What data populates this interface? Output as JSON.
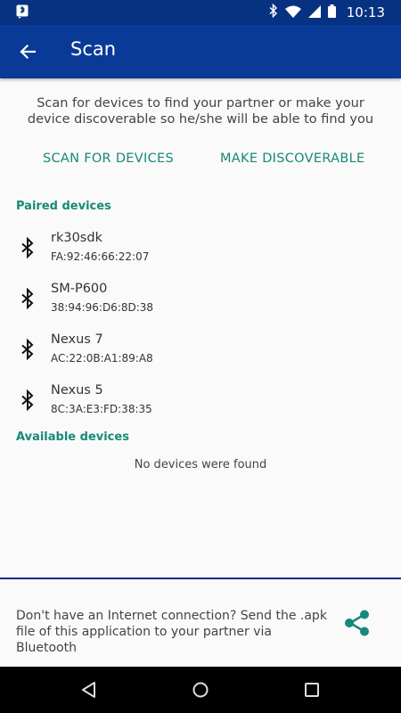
{
  "status_bar": {
    "time": "10:13",
    "left_icon": "notification-app-icon",
    "right_icons": [
      "bluetooth-icon",
      "wifi-icon",
      "signal-icon",
      "battery-icon"
    ]
  },
  "app_bar": {
    "title": "Scan",
    "back_icon": "arrow-back-icon",
    "color": "#0a3a97"
  },
  "intro_text": "Scan for devices to find your partner or make your device discoverable so he/she will be able to find you",
  "actions": {
    "scan_label": "SCAN FOR DEVICES",
    "discoverable_label": "MAKE DISCOVERABLE",
    "accent_color": "#16897a"
  },
  "paired": {
    "header": "Paired devices",
    "devices": [
      {
        "name": "rk30sdk",
        "mac": "FA:92:46:66:22:07"
      },
      {
        "name": "SM-P600",
        "mac": "38:94:96:D6:8D:38"
      },
      {
        "name": "Nexus 7",
        "mac": "AC:22:0B:A1:89:A8"
      },
      {
        "name": "Nexus 5",
        "mac": "8C:3A:E3:FD:38:35"
      }
    ]
  },
  "available": {
    "header": "Available devices",
    "empty_text": "No devices were found"
  },
  "footer": {
    "text": "Don't have an Internet connection? Send the .apk file of this application to your partner via Bluetooth",
    "share_icon": "share-icon"
  },
  "nav_bar": {
    "icons": [
      "nav-back-icon",
      "nav-home-icon",
      "nav-recents-icon"
    ]
  }
}
